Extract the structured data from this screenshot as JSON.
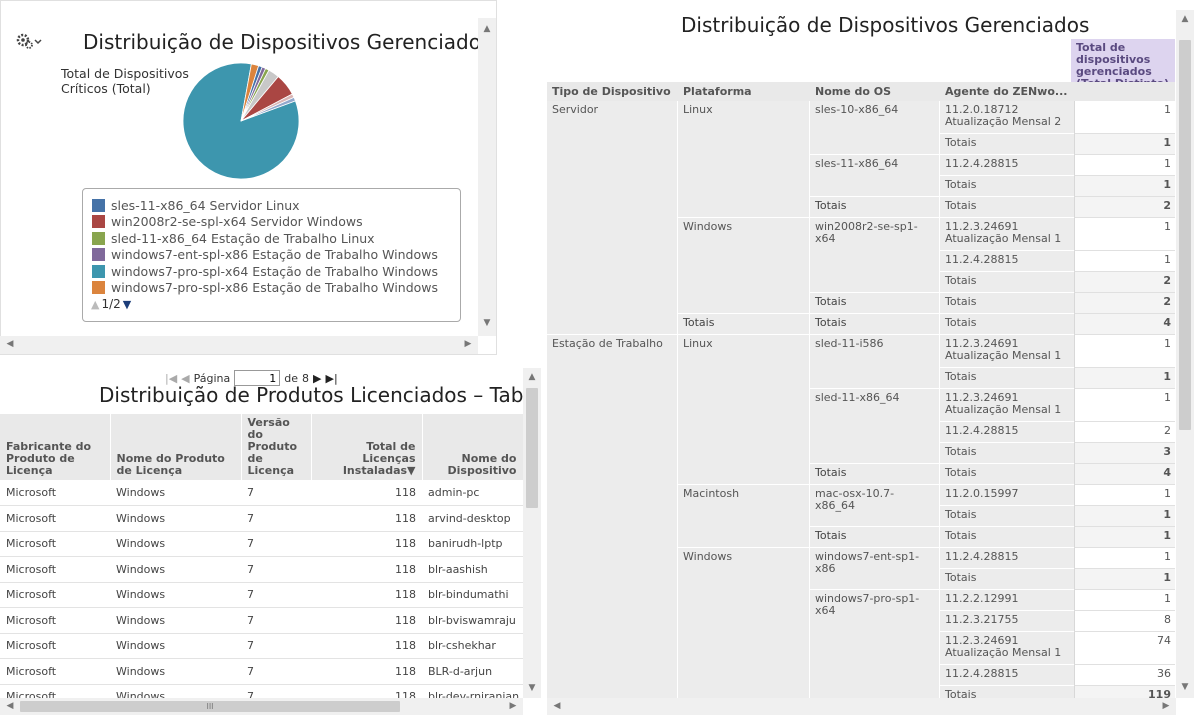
{
  "pie_panel": {
    "title": "Distribuição de Dispositivos Gerenciados",
    "subtitle": "Total de Dispositivos Críticos (Total)",
    "gear_icon": "gear-icon",
    "legend": [
      {
        "label": "sles-11-x86_64 Servidor Linux",
        "color": "#4572a7"
      },
      {
        "label": "win2008r2-se-spl-x64 Servidor Windows",
        "color": "#aa4643"
      },
      {
        "label": "sled-11-x86_64 Estação de Trabalho Linux",
        "color": "#89a54e"
      },
      {
        "label": "windows7-ent-spl-x86 Estação de Trabalho Windows",
        "color": "#80699b"
      },
      {
        "label": "windows7-pro-spl-x64 Estação de Trabalho Windows",
        "color": "#3d96ae"
      },
      {
        "label": "windows7-pro-spl-x86 Estação de Trabalho Windows",
        "color": "#db843d"
      }
    ],
    "legend_page": "1/2"
  },
  "chart_data": {
    "type": "pie",
    "title": "Distribuição de Dispositivos Gerenciados",
    "subtitle": "Total de Dispositivos Críticos (Total)",
    "slices": [
      {
        "label": "windows7-pro-spl-x64 Estação de Trabalho Windows",
        "value": 81,
        "color": "#3d96ae"
      },
      {
        "label": "windows7-pro-spl-x86 Estação de Trabalho Windows",
        "value": 2,
        "color": "#db843d"
      },
      {
        "label": "sles-11-x86_64 Servidor Linux",
        "value": 1,
        "color": "#4572a7"
      },
      {
        "label": "windows7-ent-spl-x86 Estação de Trabalho Windows",
        "value": 1,
        "color": "#80699b"
      },
      {
        "label": "sled-11-x86_64 Estação de Trabalho Linux",
        "value": 1,
        "color": "#89a54e"
      },
      {
        "label": "other",
        "value": 3,
        "color": "#c8c8c8"
      },
      {
        "label": "win2008r2-se-spl-x64 Servidor Windows",
        "value": 6,
        "color": "#aa4643"
      },
      {
        "label": "other",
        "value": 1,
        "color": "#d9b5b5"
      },
      {
        "label": "other",
        "value": 1,
        "color": "#92a8cd"
      }
    ],
    "legend_placement": "bottom"
  },
  "licensed": {
    "pager": {
      "label": "Página",
      "page": "1",
      "of": "de",
      "total": "8"
    },
    "title": "Distribuição de Produtos Licenciados – Tabular",
    "columns": [
      "Fabricante do Produto de Licença",
      "Nome do Produto de Licença",
      "Versão do Produto de Licença",
      "Total de Licenças Instaladas▼",
      "Nome do Dispositivo"
    ],
    "rows": [
      [
        "Microsoft",
        "Windows",
        "7",
        "118",
        "admin-pc"
      ],
      [
        "Microsoft",
        "Windows",
        "7",
        "118",
        "arvind-desktop"
      ],
      [
        "Microsoft",
        "Windows",
        "7",
        "118",
        "banirudh-lptp"
      ],
      [
        "Microsoft",
        "Windows",
        "7",
        "118",
        "blr-aashish"
      ],
      [
        "Microsoft",
        "Windows",
        "7",
        "118",
        "blr-bindumathi"
      ],
      [
        "Microsoft",
        "Windows",
        "7",
        "118",
        "blr-bviswamraju"
      ],
      [
        "Microsoft",
        "Windows",
        "7",
        "118",
        "blr-cshekhar"
      ],
      [
        "Microsoft",
        "Windows",
        "7",
        "118",
        "BLR-d-arjun"
      ],
      [
        "Microsoft",
        "Windows",
        "7",
        "118",
        "blr-dev-rniranjan"
      ]
    ],
    "hscroll_label": "III"
  },
  "devices": {
    "title": "Distribuição de Dispositivos Gerenciados",
    "measure_header": "Total de dispositivos gerenciados (Total Distinto)",
    "columns": [
      "Tipo de Dispositivo",
      "Plataforma",
      "Nome do OS",
      "Agente do ZENwo..."
    ],
    "totals_label": "Totais",
    "types": [
      "Servidor",
      "Estação de Trabalho"
    ],
    "platforms": [
      "Linux",
      "Windows",
      "Linux",
      "Macintosh",
      "Windows"
    ],
    "os_names": [
      "sles-10-x86_64",
      "sles-11-x86_64",
      "win2008r2-se-sp1-x64",
      "sled-11-i586",
      "sled-11-x86_64",
      "mac-osx-10.7-x86_64",
      "windows7-ent-sp1-x86",
      "windows7-pro-sp1-x64"
    ],
    "rows": [
      {
        "agent": "11.2.0.18712 Atualização Mensal 2",
        "value": "1"
      },
      {
        "agent": "Totais",
        "value": "1"
      },
      {
        "agent": "11.2.4.28815",
        "value": "1"
      },
      {
        "agent": "Totais",
        "value": "1"
      },
      {
        "agent": "Totais",
        "value": "2"
      },
      {
        "agent": "11.2.3.24691 Atualização Mensal 1",
        "value": "1"
      },
      {
        "agent": "11.2.4.28815",
        "value": "1"
      },
      {
        "agent": "Totais",
        "value": "2"
      },
      {
        "agent": "Totais",
        "value": "2"
      },
      {
        "agent": "Totais",
        "value": "4"
      },
      {
        "agent": "11.2.3.24691 Atualização Mensal 1",
        "value": "1"
      },
      {
        "agent": "Totais",
        "value": "1"
      },
      {
        "agent": "11.2.3.24691 Atualização Mensal 1",
        "value": "1"
      },
      {
        "agent": "11.2.4.28815",
        "value": "2"
      },
      {
        "agent": "Totais",
        "value": "3"
      },
      {
        "agent": "Totais",
        "value": "4"
      },
      {
        "agent": "11.2.0.15997",
        "value": "1"
      },
      {
        "agent": "Totais",
        "value": "1"
      },
      {
        "agent": "Totais",
        "value": "1"
      },
      {
        "agent": "11.2.4.28815",
        "value": "1"
      },
      {
        "agent": "Totais",
        "value": "1"
      },
      {
        "agent": "11.2.2.12991",
        "value": "1"
      },
      {
        "agent": "11.2.3.21755",
        "value": "8"
      },
      {
        "agent": "11.2.3.24691 Atualização Mensal 1",
        "value": "74"
      },
      {
        "agent": "11.2.4.28815",
        "value": "36"
      },
      {
        "agent": "Totais",
        "value": "119"
      }
    ]
  }
}
